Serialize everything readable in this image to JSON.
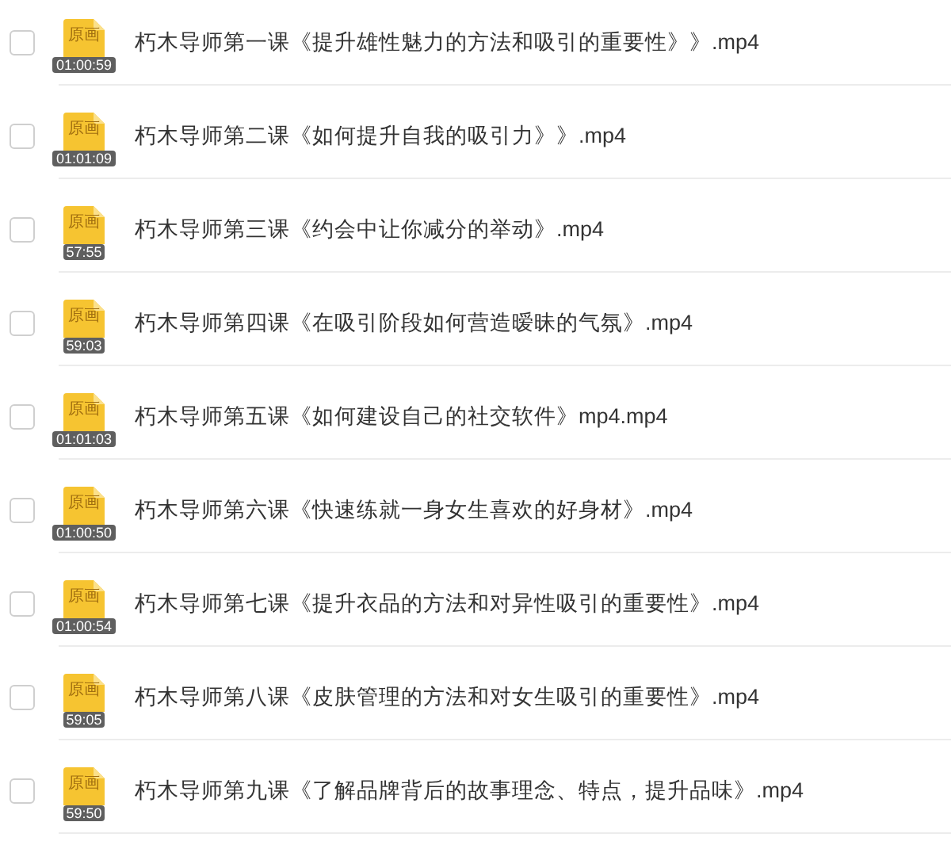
{
  "files": [
    {
      "name": "朽木导师第一课《提升雄性魅力的方法和吸引的重要性》》.mp4",
      "thumb_label": "原画",
      "duration": "01:00:59",
      "checked": false
    },
    {
      "name": "朽木导师第二课《如何提升自我的吸引力》》.mp4",
      "thumb_label": "原画",
      "duration": "01:01:09",
      "checked": false
    },
    {
      "name": "朽木导师第三课《约会中让你减分的举动》.mp4",
      "thumb_label": "原画",
      "duration": "57:55",
      "checked": false
    },
    {
      "name": "朽木导师第四课《在吸引阶段如何营造暧昧的气氛》.mp4",
      "thumb_label": "原画",
      "duration": "59:03",
      "checked": false
    },
    {
      "name": "朽木导师第五课《如何建设自己的社交软件》mp4.mp4",
      "thumb_label": "原画",
      "duration": "01:01:03",
      "checked": false
    },
    {
      "name": "朽木导师第六课《快速练就一身女生喜欢的好身材》.mp4",
      "thumb_label": "原画",
      "duration": "01:00:50",
      "checked": false
    },
    {
      "name": "朽木导师第七课《提升衣品的方法和对异性吸引的重要性》.mp4",
      "thumb_label": "原画",
      "duration": "01:00:54",
      "checked": false
    },
    {
      "name": "朽木导师第八课《皮肤管理的方法和对女生吸引的重要性》.mp4",
      "thumb_label": "原画",
      "duration": "59:05",
      "checked": false
    },
    {
      "name": "朽木导师第九课《了解品牌背后的故事理念、特点，提升品味》.mp4",
      "thumb_label": "原画",
      "duration": "59:50",
      "checked": false
    }
  ]
}
